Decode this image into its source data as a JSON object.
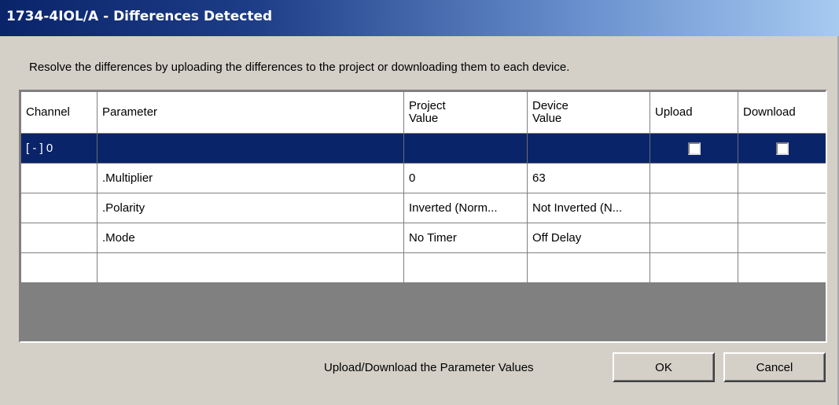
{
  "window": {
    "title": "1734-4IOL/A - Differences Detected"
  },
  "instructions": "Resolve the differences by uploading the differences to the project or downloading them to each device.",
  "table": {
    "headers": {
      "channel": "Channel",
      "parameter": "Parameter",
      "project_value": "Project Value",
      "device_value": "Device Value",
      "upload": "Upload",
      "download": "Download"
    },
    "rows": [
      {
        "channel": "[ - ] 0",
        "parameter": "",
        "project_value": "",
        "device_value": "",
        "upload_checked": false,
        "download_checked": false,
        "selected": true
      },
      {
        "channel": "",
        "parameter": ".Multiplier",
        "project_value": "0",
        "device_value": "63"
      },
      {
        "channel": "",
        "parameter": ".Polarity",
        "project_value": "Inverted (Norm...",
        "device_value": "Not Inverted (N..."
      },
      {
        "channel": "",
        "parameter": ".Mode",
        "project_value": "No Timer",
        "device_value": "Off Delay"
      },
      {
        "channel": "",
        "parameter": "",
        "project_value": "",
        "device_value": ""
      }
    ]
  },
  "footer": {
    "label": "Upload/Download the Parameter Values",
    "ok_label": "OK",
    "cancel_label": "Cancel"
  },
  "colors": {
    "selection": "#0a246a",
    "dialog_bg": "#d4d0c8",
    "grid_empty_bg": "#808080"
  }
}
